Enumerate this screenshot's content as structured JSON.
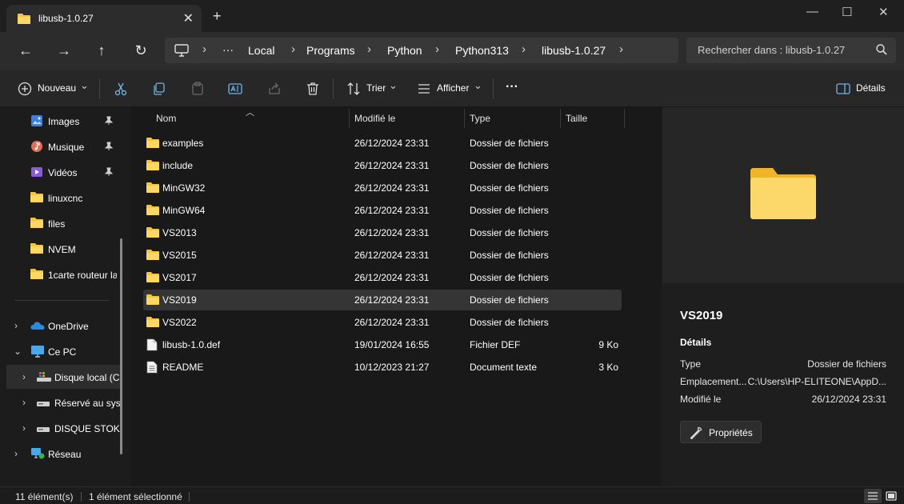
{
  "window": {
    "tab_title": "libusb-1.0.27",
    "tab_close": "✕",
    "new_tab": "+",
    "minimize": "—",
    "maximize": "☐",
    "close": "✕"
  },
  "nav": {
    "back": "←",
    "forward": "→",
    "up": "↑",
    "refresh": "↻",
    "overflow": "···",
    "breadcrumbs": [
      "Local",
      "Programs",
      "Python",
      "Python313",
      "libusb-1.0.27"
    ],
    "separator": "›",
    "search_placeholder": "Rechercher dans : libusb-1.0.27"
  },
  "toolbar": {
    "new_label": "Nouveau",
    "sort_label": "Trier",
    "view_label": "Afficher",
    "more": "···",
    "details_label": "Détails",
    "dropdown": "⌄"
  },
  "sidebar": {
    "items": [
      {
        "label": "Images",
        "icon": "images-icon",
        "pinned": true
      },
      {
        "label": "Musique",
        "icon": "music-icon",
        "pinned": true
      },
      {
        "label": "Vidéos",
        "icon": "videos-icon",
        "pinned": true
      },
      {
        "label": "linuxcnc",
        "icon": "folder-icon"
      },
      {
        "label": "files",
        "icon": "folder-icon"
      },
      {
        "label": "NVEM",
        "icon": "folder-icon"
      },
      {
        "label": "1carte routeur la",
        "icon": "folder-icon"
      }
    ],
    "tree": [
      {
        "label": "OneDrive",
        "icon": "onedrive-icon",
        "chevron": "›"
      },
      {
        "label": "Ce PC",
        "icon": "pc-icon",
        "chevron": "⌄"
      },
      {
        "label": "Disque local (C",
        "icon": "drive-icon",
        "chevron": "›"
      },
      {
        "label": "Réservé au syst",
        "icon": "drive-icon",
        "chevron": "›"
      },
      {
        "label": "DISQUE STOKA",
        "icon": "drive-icon",
        "chevron": "›"
      },
      {
        "label": "Réseau",
        "icon": "network-icon",
        "chevron": "›"
      }
    ]
  },
  "columns": {
    "name": "Nom",
    "modified": "Modifié le",
    "type": "Type",
    "size": "Taille"
  },
  "files": [
    {
      "name": "examples",
      "modified": "26/12/2024 23:31",
      "type": "Dossier de fichiers",
      "size": "",
      "kind": "folder"
    },
    {
      "name": "include",
      "modified": "26/12/2024 23:31",
      "type": "Dossier de fichiers",
      "size": "",
      "kind": "folder"
    },
    {
      "name": "MinGW32",
      "modified": "26/12/2024 23:31",
      "type": "Dossier de fichiers",
      "size": "",
      "kind": "folder"
    },
    {
      "name": "MinGW64",
      "modified": "26/12/2024 23:31",
      "type": "Dossier de fichiers",
      "size": "",
      "kind": "folder"
    },
    {
      "name": "VS2013",
      "modified": "26/12/2024 23:31",
      "type": "Dossier de fichiers",
      "size": "",
      "kind": "folder"
    },
    {
      "name": "VS2015",
      "modified": "26/12/2024 23:31",
      "type": "Dossier de fichiers",
      "size": "",
      "kind": "folder"
    },
    {
      "name": "VS2017",
      "modified": "26/12/2024 23:31",
      "type": "Dossier de fichiers",
      "size": "",
      "kind": "folder"
    },
    {
      "name": "VS2019",
      "modified": "26/12/2024 23:31",
      "type": "Dossier de fichiers",
      "size": "",
      "kind": "folder",
      "selected": true
    },
    {
      "name": "VS2022",
      "modified": "26/12/2024 23:31",
      "type": "Dossier de fichiers",
      "size": "",
      "kind": "folder"
    },
    {
      "name": "libusb-1.0.def",
      "modified": "19/01/2024 16:55",
      "type": "Fichier DEF",
      "size": "9 Ko",
      "kind": "file"
    },
    {
      "name": "README",
      "modified": "10/12/2023 21:27",
      "type": "Document texte",
      "size": "3 Ko",
      "kind": "text"
    }
  ],
  "details": {
    "name": "VS2019",
    "section": "Détails",
    "type_key": "Type",
    "type_val": "Dossier de fichiers",
    "loc_key": "Emplacement...",
    "loc_val": "C:\\Users\\HP-ELITEONE\\AppD...",
    "mod_key": "Modifié le",
    "mod_val": "26/12/2024 23:31",
    "props_label": "Propriétés"
  },
  "status": {
    "count": "11 élément(s)",
    "selected": "1 élément sélectionné"
  },
  "colors": {
    "folder": "#f5c542",
    "accent": "#4cc2ff"
  }
}
